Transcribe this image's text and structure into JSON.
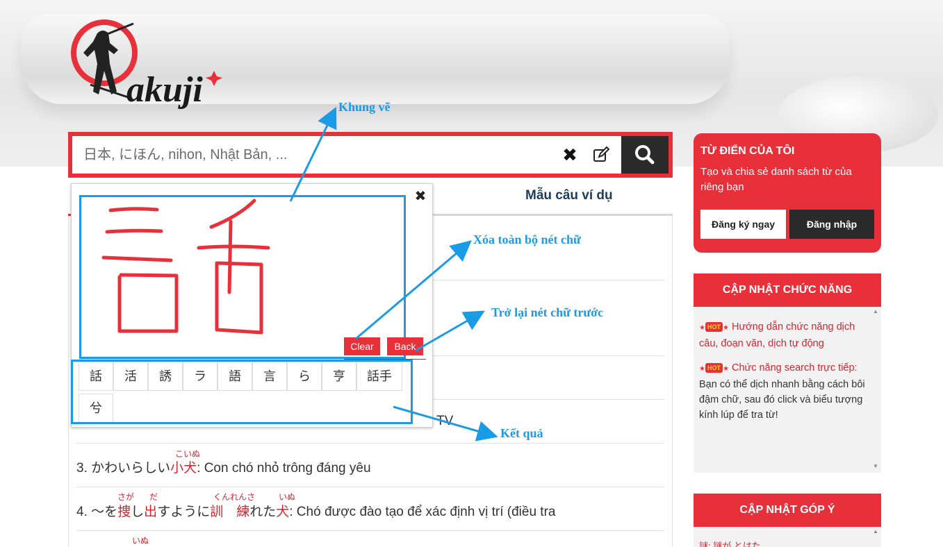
{
  "logo": {
    "text": "akuji"
  },
  "search": {
    "placeholder": "日本, にほん, nihon, Nhật Bản, ..."
  },
  "tabs": {
    "examples": "Mẫu câu ví dụ"
  },
  "handwriting": {
    "clear_label": "Clear",
    "back_label": "Back",
    "results": [
      "話",
      "活",
      "誘",
      "ラ",
      "語",
      "言",
      "ら",
      "亨",
      "話手",
      "兮"
    ]
  },
  "examples": [
    {
      "number": "3. ",
      "pre": "かわいらしい",
      "red": "小犬",
      "post": ": Con chó nhỏ trông đáng yêu",
      "furigana": [
        "こいぬ"
      ]
    },
    {
      "number": "4. ",
      "pre": "～を",
      "red1": "捜",
      "mid1": "し",
      "red2": "出",
      "mid2": "すように",
      "red3": "訓　練",
      "mid3": "れた",
      "red4": "犬",
      "post": ": Chó được đào tạo để xác định vị trí (điều tra",
      "furigana": [
        "さが",
        "だ",
        "くんれんさ",
        "いぬ"
      ]
    }
  ],
  "partial_text": {
    "tv": "TV",
    "furi_bottom": "いぬ"
  },
  "annotations": {
    "canvas": "Khung vẽ",
    "clear": "Xóa toàn bộ nét chữ",
    "back": "Trở lại nét chữ trước",
    "results": "Kết quả"
  },
  "sidebar": {
    "my_dict": {
      "title": "TỪ ĐIỂN CỦA TÔI",
      "desc": "Tạo và chia sẻ danh sách từ của riêng bạn",
      "register": "Đăng ký ngay",
      "login": "Đăng nhập"
    },
    "updates": {
      "title": "CẬP NHẬT CHỨC NĂNG",
      "items": [
        {
          "link": "Hướng dẫn chức năng dịch câu, đoạn văn, dịch tự động",
          "text": ""
        },
        {
          "link": "Chức năng search trực tiếp:",
          "text": " Bạn có thể dịch nhanh bằng cách bôi đậm chữ, sau đó click và biểu tượng kính lúp để tra từ!"
        }
      ],
      "hot_label": "HOT"
    },
    "feedback": {
      "title": "CẬP NHẬT GÓP Ý",
      "partial": "謎: 謎が とはた"
    }
  },
  "icons": {
    "clear_search": "close-icon",
    "handwrite": "edit-icon",
    "search": "search-icon",
    "popup_close": "close-icon"
  }
}
